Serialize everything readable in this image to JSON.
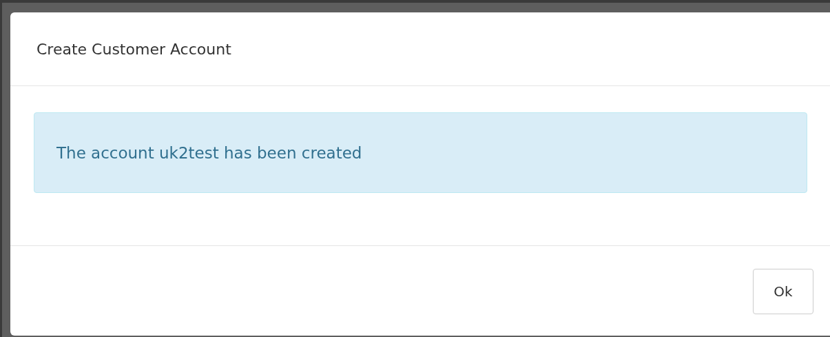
{
  "dialog": {
    "title": "Create Customer Account",
    "message": "The account uk2test has been created",
    "buttons": [
      "Ok"
    ]
  }
}
